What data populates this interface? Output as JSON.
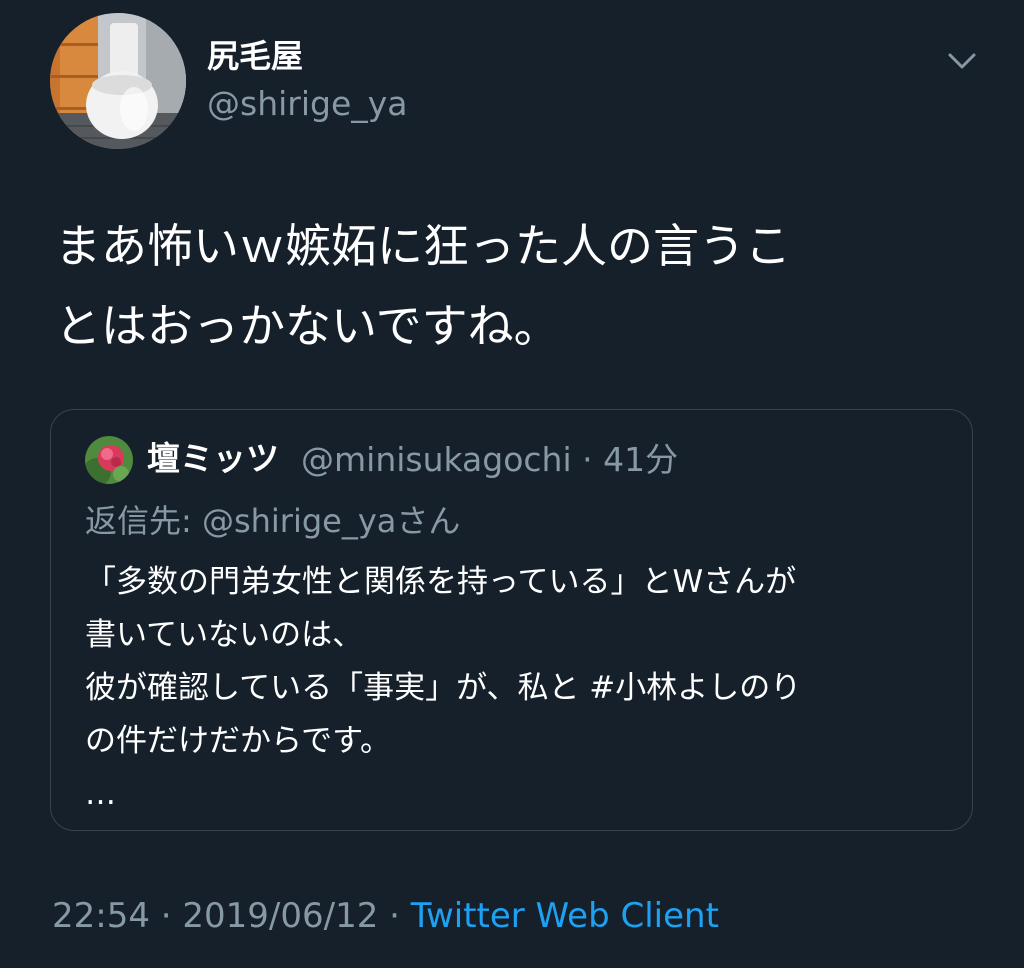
{
  "tweet": {
    "author": {
      "display_name": "尻毛屋",
      "handle": "@shirige_ya"
    },
    "text": "まあ怖いｗ嫉妬に狂った人の言うこ\nとはおっかないですね。",
    "timestamp": "22:54 · 2019/06/12 · ",
    "client": "Twitter Web Client"
  },
  "quoted_tweet": {
    "author": {
      "display_name": "壇ミッツ",
      "handle_time": "@minisukagochi · 41分"
    },
    "reply_to": "返信先: @shirige_yaさん",
    "text": "「多数の門弟女性と関係を持っている」とWさんが\n書いていないのは、\n彼が確認している「事実」が、私と #小林よしのり\nの件だけだからです。\n…"
  },
  "icons": {
    "menu": "chevron-down-icon",
    "avatar": "toilet-photo",
    "quoted_avatar": "flower-photo"
  },
  "colors": {
    "background": "#15202b",
    "text_primary": "#ffffff",
    "text_secondary": "#8899a6",
    "link": "#1da1f2",
    "border": "#38444d"
  }
}
